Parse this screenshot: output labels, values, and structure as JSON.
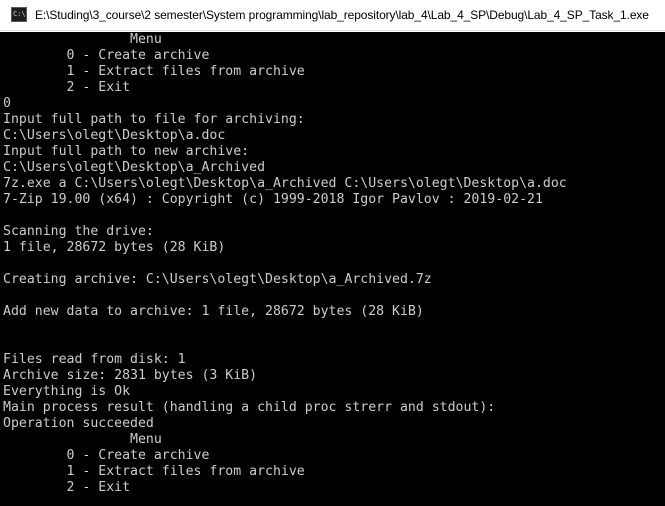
{
  "window": {
    "title": "E:\\Studing\\3_course\\2 semester\\System programming\\lab_repository\\lab_4\\Lab_4_SP\\Debug\\Lab_4_SP_Task_1.exe",
    "icon_label": "C:\\"
  },
  "console": {
    "lines": [
      "                Menu",
      "        0 - Create archive",
      "        1 - Extract files from archive",
      "        2 - Exit",
      "0",
      "Input full path to file for archiving:",
      "C:\\Users\\olegt\\Desktop\\a.doc",
      "Input full path to new archive:",
      "C:\\Users\\olegt\\Desktop\\a_Archived",
      "7z.exe a C:\\Users\\olegt\\Desktop\\a_Archived C:\\Users\\olegt\\Desktop\\a.doc",
      "7-Zip 19.00 (x64) : Copyright (c) 1999-2018 Igor Pavlov : 2019-02-21",
      "",
      "Scanning the drive:",
      "1 file, 28672 bytes (28 KiB)",
      "",
      "Creating archive: C:\\Users\\olegt\\Desktop\\a_Archived.7z",
      "",
      "Add new data to archive: 1 file, 28672 bytes (28 KiB)",
      "",
      "",
      "Files read from disk: 1",
      "Archive size: 2831 bytes (3 KiB)",
      "Everything is Ok",
      "Main process result (handling a child proc strerr and stdout):",
      "Operation succeeded",
      "                Menu",
      "        0 - Create archive",
      "        1 - Extract files from archive",
      "        2 - Exit"
    ]
  },
  "colors": {
    "console_background": "#000000",
    "console_text": "#cccccc",
    "titlebar_background": "#ffffff"
  }
}
